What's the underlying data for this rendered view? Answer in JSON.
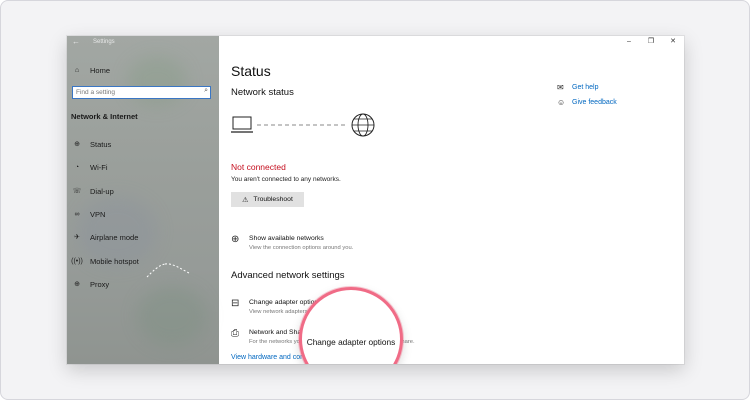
{
  "window": {
    "title": "Settings"
  },
  "sidebar": {
    "home_label": "Home",
    "search": {
      "placeholder": "Find a setting"
    },
    "section_title": "Network & Internet",
    "items": [
      {
        "label": "Status",
        "icon": "status-icon"
      },
      {
        "label": "Wi-Fi",
        "icon": "wifi-icon"
      },
      {
        "label": "Dial-up",
        "icon": "dialup-icon"
      },
      {
        "label": "VPN",
        "icon": "vpn-icon"
      },
      {
        "label": "Airplane mode",
        "icon": "airplane-icon"
      },
      {
        "label": "Mobile hotspot",
        "icon": "hotspot-icon"
      },
      {
        "label": "Proxy",
        "icon": "globe-icon"
      }
    ]
  },
  "main": {
    "title": "Status",
    "network_status_heading": "Network status",
    "connection_status": "Not connected",
    "connection_message": "You aren't connected to any networks.",
    "troubleshoot_label": "Troubleshoot",
    "show_networks": {
      "title": "Show available networks",
      "description": "View the connection options around you."
    },
    "advanced_heading": "Advanced network settings",
    "change_adapter": {
      "title": "Change adapter options",
      "description": "View network adapters and change connection settings."
    },
    "sharing_center": {
      "title": "Network and Sharing Center",
      "description": "For the networks you connect to, decide what you want to share."
    },
    "hardware_link": "View hardware and connection properties"
  },
  "help": {
    "get_help": "Get help",
    "give_feedback": "Give feedback"
  },
  "colors": {
    "accent": "#0067c0",
    "error": "#c50f1f",
    "highlight_ring": "#f06b86"
  }
}
